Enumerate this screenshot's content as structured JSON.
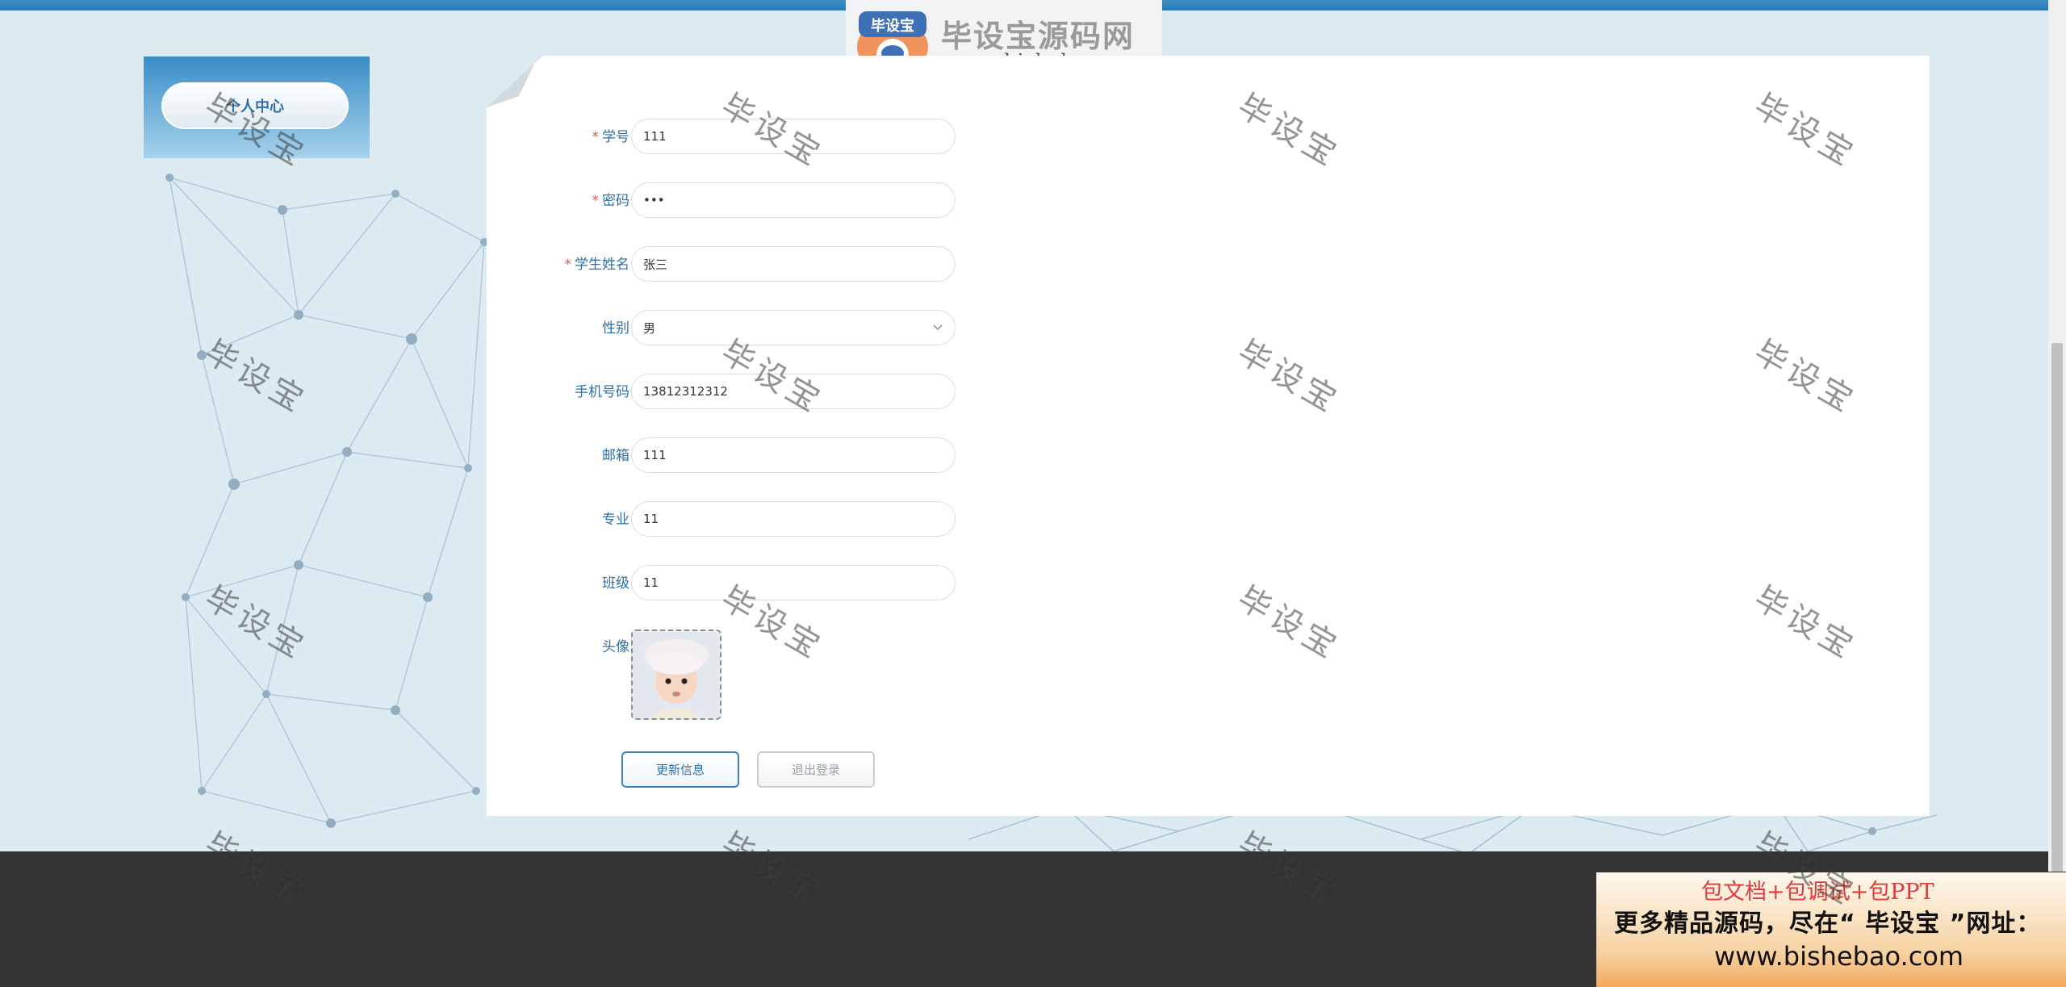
{
  "brand": {
    "name": "毕设宝源码网",
    "url": "www.bishebao.com",
    "badge_text": "毕设宝"
  },
  "sidebar": {
    "menu_label": "个人中心"
  },
  "form": {
    "fields": [
      {
        "label": "学号",
        "required": true,
        "value": "111"
      },
      {
        "label": "密码",
        "required": true,
        "value": "•••"
      },
      {
        "label": "学生姓名",
        "required": true,
        "value": "张三"
      },
      {
        "label": "性别",
        "required": false,
        "value": "男"
      },
      {
        "label": "手机号码",
        "required": false,
        "value": "13812312312"
      },
      {
        "label": "邮箱",
        "required": false,
        "value": "111"
      },
      {
        "label": "专业",
        "required": false,
        "value": "11"
      },
      {
        "label": "班级",
        "required": false,
        "value": "11"
      }
    ],
    "avatar_label": "头像",
    "required_mark": "*"
  },
  "actions": {
    "update_label": "更新信息",
    "logout_label": "退出登录"
  },
  "promo": {
    "line1": "包文档+包调试+包PPT",
    "line2": "更多精品源码，尽在“ 毕设宝 ”网址：",
    "line3": "www.bishebao.com"
  },
  "watermark": "毕设宝",
  "colors": {
    "accent": "#2e6fa8",
    "required": "#e2554f",
    "topbar": "#3d8fc4",
    "footer": "#333333"
  }
}
